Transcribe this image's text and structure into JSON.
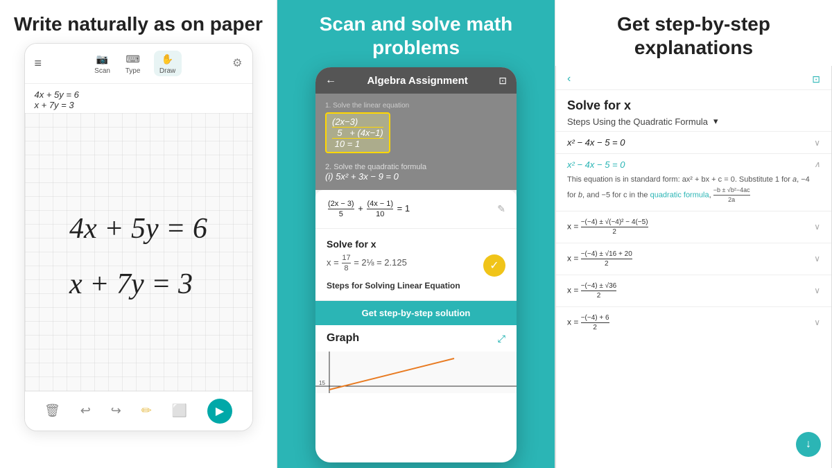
{
  "col1": {
    "heading": "Write naturally as on paper",
    "toolbar": {
      "scan_label": "Scan",
      "type_label": "Type",
      "draw_label": "Draw"
    },
    "equations_small": {
      "line1": "4x + 5y = 6",
      "line2": "x + 7y = 3"
    },
    "bottom_icons": {
      "trash": "🗑",
      "undo": "↩",
      "redo": "↪",
      "pencil": "✏",
      "eraser": "🧹"
    }
  },
  "col2": {
    "heading": "Scan and solve math problems",
    "phone_title": "Algebra Assignment",
    "problem1_label": "1. Solve the linear equation",
    "problem1_eq": "(2x−3)/5 + (4x−1)/10 = 1",
    "problem2_label": "2. Solve the quadratic formula",
    "problem2_eq": "(i) 5x² + 3x − 9 = 0",
    "solve_title": "Solve for x",
    "solve_eq": "x = 17/8 = 2⅛ = 2.125",
    "steps_label": "Steps for Solving Linear Equation",
    "get_steps_btn": "Get step-by-step solution",
    "graph_label": "Graph"
  },
  "col3": {
    "heading": "Get step-by-step explanations",
    "solve_title": "Solve for x",
    "formula_label": "Steps Using the Quadratic Formula",
    "steps": [
      {
        "eq": "x² − 4x − 5 = 0",
        "expanded": false
      },
      {
        "eq": "x² − 4x − 5 = 0",
        "expanded": true
      },
      {
        "eq": "x = (−(−4) ± √(−4)² − 4(−5)) / 2",
        "expanded": false
      },
      {
        "eq": "x = (−(−4) ± √16 + 20) / 2",
        "expanded": false
      },
      {
        "eq": "x = (−(−4) ± √36) / 2",
        "expanded": false
      },
      {
        "eq": "x = (−4) + 6 / 2",
        "expanded": false
      }
    ],
    "description": "This equation is in standard form: ax² + bx + c = 0. Substitute 1 for a, −4 for b, and −5 for c in the quadratic formula,"
  }
}
